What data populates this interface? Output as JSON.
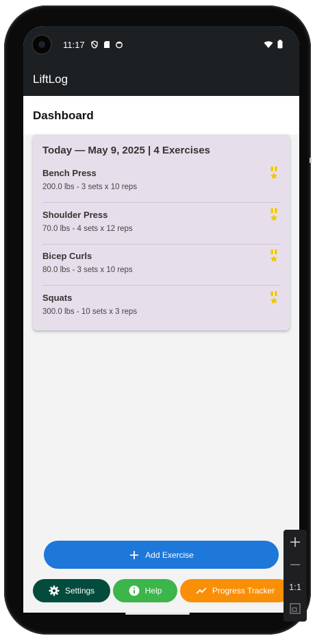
{
  "status_bar": {
    "time": "11:17"
  },
  "app_bar": {
    "title": "LiftLog"
  },
  "page_header": {
    "title": "Dashboard"
  },
  "today_card": {
    "title": "Today — May 9, 2025 | 4 Exercises",
    "exercises": [
      {
        "name": "Bench Press",
        "detail": "200.0 lbs - 3 sets x 10 reps"
      },
      {
        "name": "Shoulder Press",
        "detail": "70.0 lbs - 4 sets x 12 reps"
      },
      {
        "name": "Bicep Curls",
        "detail": "80.0 lbs - 3 sets x 10 reps"
      },
      {
        "name": "Squats",
        "detail": "300.0 lbs - 10 sets x 3 reps"
      }
    ]
  },
  "buttons": {
    "add_exercise": "Add Exercise",
    "settings": "Settings",
    "help": "Help",
    "progress_tracker": "Progress Tracker"
  },
  "zoom_controls": {
    "ratio": "1:1"
  },
  "colors": {
    "app_bar": "#1d2023",
    "card": "#e6dfeb",
    "medal": "#f2c500",
    "add_button": "#1e78d9",
    "settings_button": "#034c3d",
    "help_button": "#3cb54a",
    "progress_button": "#f98f06"
  },
  "icons": [
    "camera-icon",
    "vpn-icon",
    "sd-card-icon",
    "face-icon",
    "wifi-icon",
    "battery-icon",
    "medal-icon",
    "plus-icon",
    "gear-icon",
    "info-icon",
    "trending-up-icon",
    "zoom-in-icon",
    "zoom-out-icon",
    "fit-screen-icon"
  ]
}
